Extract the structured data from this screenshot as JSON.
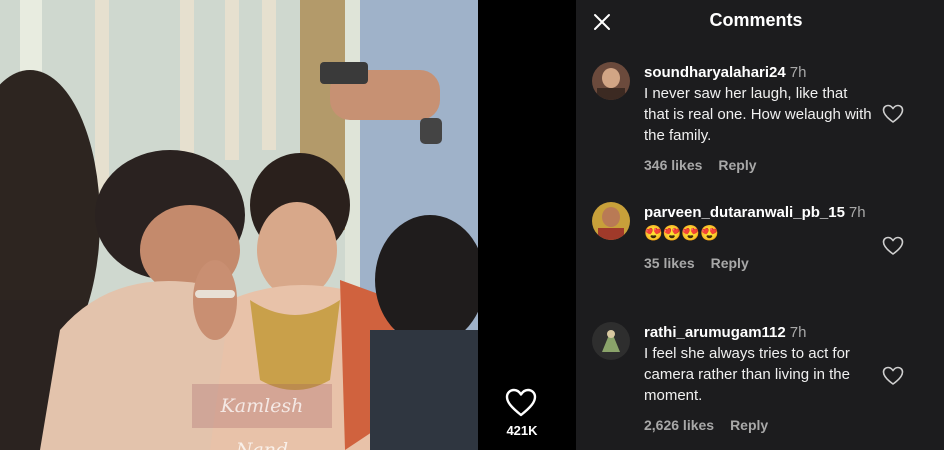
{
  "panel": {
    "title": "Comments"
  },
  "video": {
    "like_count": "421K",
    "watermark": "Kamlesh Nand"
  },
  "comments": [
    {
      "username": "soundharyalahari24",
      "time": "7h",
      "text": "I never saw her laugh, like that that is real one. How welaugh with the family.",
      "likes": "346 likes",
      "reply": "Reply"
    },
    {
      "username": "parveen_dutaranwali_pb_15",
      "time": "7h",
      "text": "😍😍😍😍",
      "likes": "35 likes",
      "reply": "Reply"
    },
    {
      "username": "rathi_arumugam112",
      "time": "7h",
      "text": "I feel she always tries to act for camera rather than living in the moment.",
      "likes": "2,626 likes",
      "reply": "Reply"
    }
  ],
  "icons": {
    "close": "close-icon",
    "heart": "heart-icon",
    "like_outline": "heart-outline-icon"
  }
}
